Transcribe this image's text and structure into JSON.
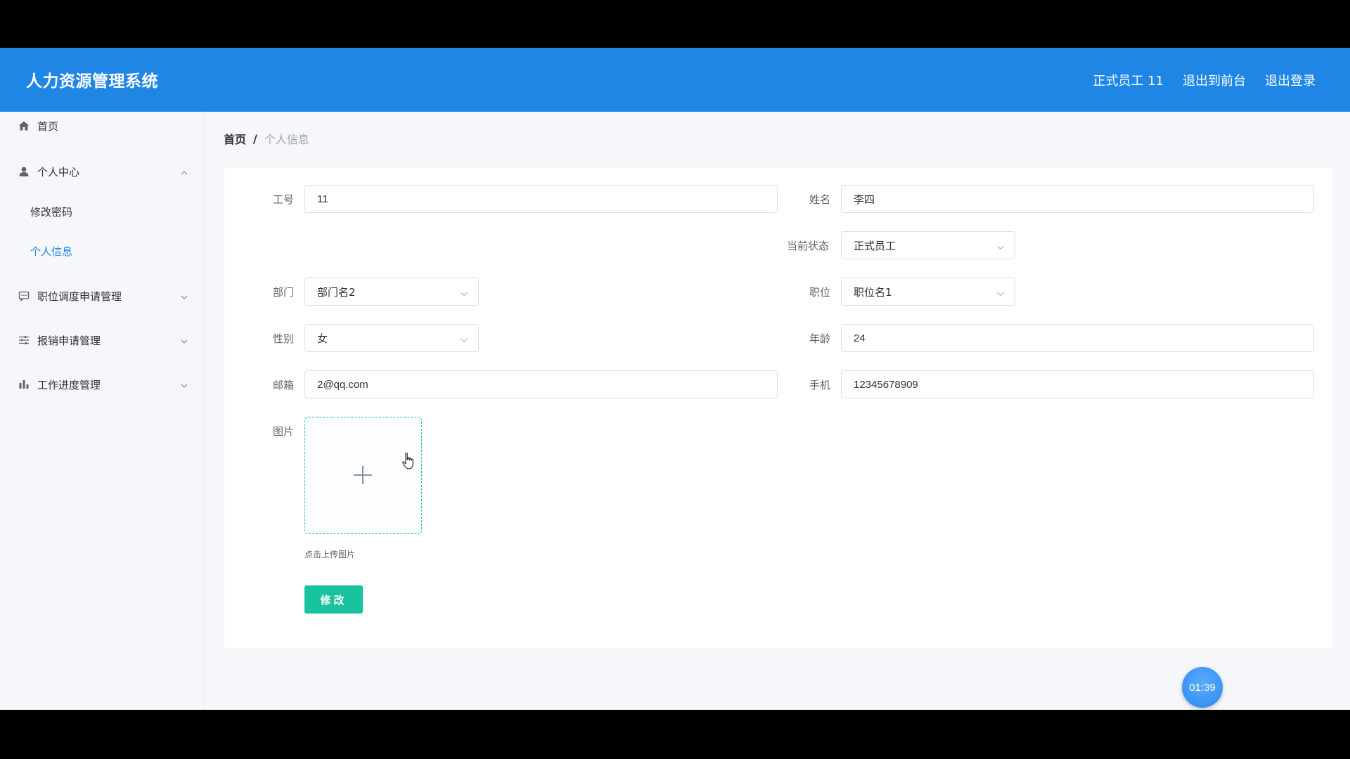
{
  "header": {
    "app_title": "人力资源管理系统",
    "nav": {
      "user": "正式员工 11",
      "to_frontend": "退出到前台",
      "logout": "退出登录"
    }
  },
  "sidebar": {
    "items": [
      {
        "label": "首页",
        "icon": "home-icon"
      },
      {
        "label": "个人中心",
        "icon": "user-icon",
        "expanded": true,
        "children": [
          {
            "label": "修改密码"
          },
          {
            "label": "个人信息",
            "active": true
          }
        ]
      },
      {
        "label": "职位调度申请管理",
        "icon": "message-icon"
      },
      {
        "label": "报销申请管理",
        "icon": "sliders-icon"
      },
      {
        "label": "工作进度管理",
        "icon": "bar-chart-icon"
      }
    ]
  },
  "breadcrumb": {
    "home": "首页",
    "separator": "/",
    "current": "个人信息"
  },
  "form": {
    "employee_id": {
      "label": "工号",
      "value": "11"
    },
    "name": {
      "label": "姓名",
      "value": "李四"
    },
    "status": {
      "label": "当前状态",
      "value": "正式员工"
    },
    "department": {
      "label": "部门",
      "value": "部门名2"
    },
    "position": {
      "label": "职位",
      "value": "职位名1"
    },
    "gender": {
      "label": "性别",
      "value": "女"
    },
    "age": {
      "label": "年龄",
      "value": "24"
    },
    "email": {
      "label": "邮箱",
      "value": "2@qq.com"
    },
    "phone": {
      "label": "手机",
      "value": "12345678909"
    },
    "image": {
      "label": "图片",
      "tip": "点击上传图片"
    },
    "submit_label": "修改"
  },
  "timer": {
    "value": "01:39"
  },
  "colors": {
    "header_bg": "#1f86e6",
    "accent_active": "#1f86e6",
    "button_green": "#19c39d"
  }
}
